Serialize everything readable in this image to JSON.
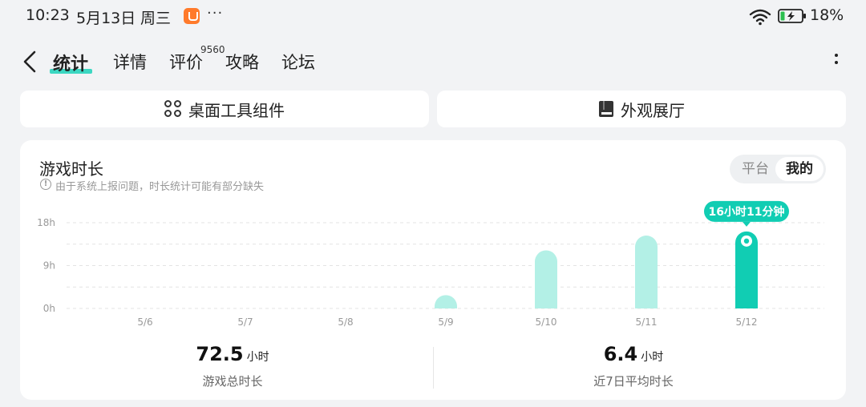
{
  "status_bar": {
    "time": "10:23",
    "date": "5月13日",
    "weekday": "周三",
    "more": "···",
    "battery": "18%",
    "icons": [
      "app-notification-icon",
      "wifi-icon",
      "battery-charging-icon"
    ]
  },
  "nav": {
    "tabs": [
      {
        "label": "统计",
        "active": true
      },
      {
        "label": "详情"
      },
      {
        "label": "评价",
        "badge": "9560"
      },
      {
        "label": "攻略"
      },
      {
        "label": "论坛"
      }
    ],
    "accent": "#1cd1b8"
  },
  "tools": {
    "widgets_label": "桌面工具组件",
    "showroom_label": "外观展厅"
  },
  "card": {
    "title": "游戏时长",
    "note": "由于系统上报问题，时长统计可能有部分缺失",
    "toggle": {
      "platform": "平台",
      "mine": "我的"
    }
  },
  "chart_data": {
    "type": "bar",
    "categories": [
      "5/6",
      "5/7",
      "5/8",
      "5/9",
      "5/10",
      "5/11",
      "5/12"
    ],
    "values": [
      0,
      0,
      0,
      0.9,
      12.2,
      15.3,
      16.18
    ],
    "highlight_index": 6,
    "highlight_label": "16小时11分钟",
    "y_ticks": [
      "0h",
      "9h",
      "18h"
    ],
    "ylim": [
      0,
      18
    ],
    "grid": true,
    "colors": {
      "bar": "#b3f0e6",
      "highlight": "#11cdb3"
    }
  },
  "stats": {
    "total_value": "72.5",
    "total_unit": "小时",
    "total_label": "游戏总时长",
    "avg_value": "6.4",
    "avg_unit": "小时",
    "avg_label": "近7日平均时长"
  }
}
